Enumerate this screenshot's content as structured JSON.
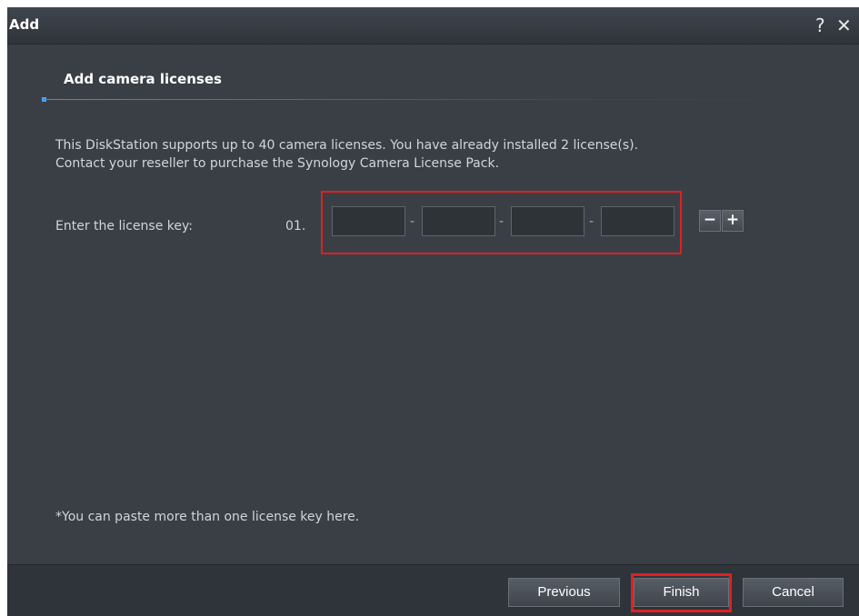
{
  "window": {
    "title": "Add",
    "help_icon": "?",
    "close_icon": "✕"
  },
  "section": {
    "title": "Add camera licenses"
  },
  "description": {
    "line1": "This DiskStation supports up to 40 camera licenses. You have already installed 2 license(s).",
    "line2": "Contact your reseller to purchase the Synology Camera License Pack."
  },
  "license": {
    "label": "Enter the license key:",
    "index": "01.",
    "separator": "-",
    "fields": [
      "",
      "",
      "",
      ""
    ],
    "remove_label": "−",
    "add_label": "+"
  },
  "note": "*You can paste more than one license key here.",
  "footer": {
    "previous_label": "Previous",
    "finish_label": "Finish",
    "cancel_label": "Cancel"
  },
  "colors": {
    "background": "#3a3f46",
    "highlight": "#e02020",
    "accent": "#3f8fd8"
  }
}
